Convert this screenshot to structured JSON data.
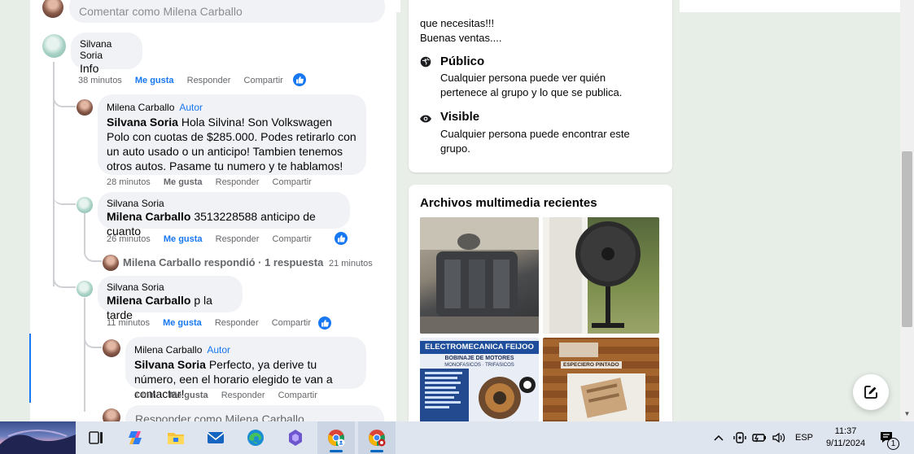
{
  "composer_top": {
    "placeholder": "Comentar como Milena Carballo"
  },
  "comments": [
    {
      "author": "Silvana Soria",
      "text": "Info",
      "time": "38 minutos",
      "like": "Me gusta",
      "reply": "Responder",
      "share": "Compartir",
      "liked": true
    },
    {
      "author": "Milena Carballo",
      "badge": "Autor",
      "mention": "Silvana Soria",
      "text": " Hola Silvina! Son Volkswagen Polo con cuotas de $285.000. Podes retirarlo con un auto usado o un anticipo! Tambien tenemos otros autos. Pasame tu numero y te hablamos!",
      "time": "28 minutos",
      "like": "Me gusta",
      "reply": "Responder",
      "share": "Compartir"
    },
    {
      "author": "Silvana Soria",
      "mention": "Milena Carballo",
      "text": " 3513228588 anticipo de cuanto",
      "time": "26 minutos",
      "like": "Me gusta",
      "reply": "Responder",
      "share": "Compartir",
      "liked": true
    },
    {
      "author": "Silvana Soria",
      "mention": "Milena Carballo",
      "text": " p la tarde",
      "time": "11 minutos",
      "like": "Me gusta",
      "reply": "Responder",
      "share": "Compartir",
      "liked": true
    },
    {
      "author": "Milena Carballo",
      "badge": "Autor",
      "mention": "Silvana Soria",
      "text": " Perfecto, ya derive tu número, een el horario elegido te van a contactar!",
      "time": "1 min",
      "like": "Me gusta",
      "reply": "Responder",
      "share": "Compartir"
    }
  ],
  "reply_summary": {
    "text": "Milena Carballo respondió · 1 respuesta",
    "time": "21 minutos"
  },
  "composer_reply": {
    "placeholder": "Responder como Milena Carballo"
  },
  "group_info": {
    "description_tail_1": "que necesitas!!!",
    "description_tail_2": "Buenas ventas....",
    "rows": [
      {
        "title": "Público",
        "text": "Cualquier persona puede ver quién pertenece al grupo y lo que se publica.",
        "icon": "globe-icon"
      },
      {
        "title": "Visible",
        "text": "Cualquier persona puede encontrar este grupo.",
        "icon": "eye-icon"
      }
    ]
  },
  "media": {
    "title": "Archivos multimedia recientes",
    "tile3_banner": "ELECTROMECANICA FEIJOO",
    "tile3_sub": "BOBINAJE DE MOTORES",
    "tile3_sub2": "MONOFASICOS · TRIFASICOS",
    "tile4_label": "ESPECIERO PINTADO"
  },
  "taskbar": {
    "language": "ESP",
    "time": "11:37",
    "date": "9/11/2024",
    "notifications": "1",
    "apps": [
      "task-view-icon",
      "copilot-icon",
      "file-explorer-icon",
      "mail-icon",
      "edge-icon",
      "copilot-app-icon",
      "chrome-profile-icon",
      "chrome-icon"
    ]
  },
  "colors": {
    "accent": "#1877f2",
    "muted": "#65676b",
    "bubble": "#f0f2f5",
    "page_bg": "#e9efe8"
  }
}
